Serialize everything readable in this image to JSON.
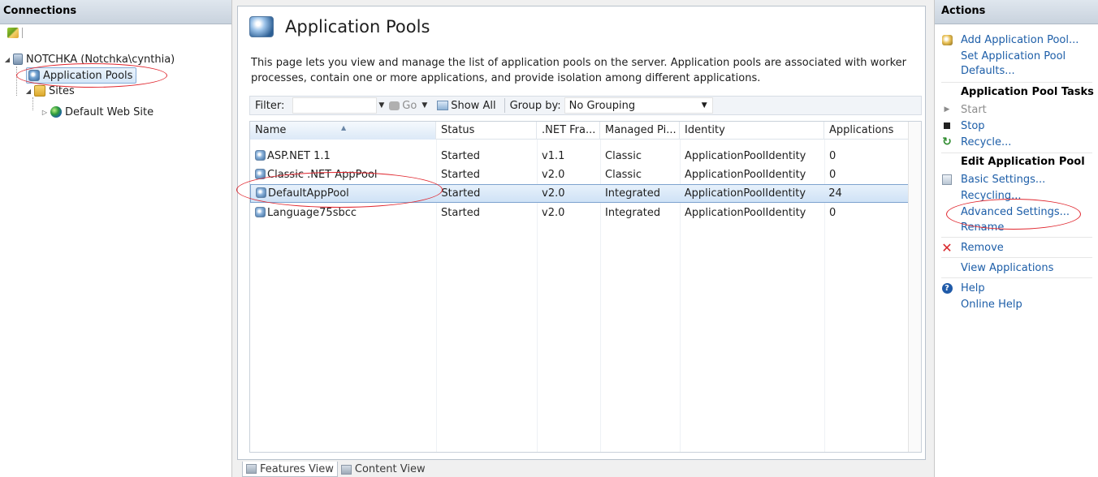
{
  "connections": {
    "title": "Connections",
    "tree": {
      "server": "NOTCHKA (Notchka\\cynthia)",
      "app_pools": "Application Pools",
      "sites": "Sites",
      "default_site": "Default Web Site"
    }
  },
  "main": {
    "title": "Application Pools",
    "description": "This page lets you view and manage the list of application pools on the server. Application pools are associated with worker processes, contain one or more applications, and provide isolation among different applications.",
    "filter": {
      "label": "Filter:",
      "value": "",
      "go": "Go",
      "show_all": "Show All",
      "group_by_label": "Group by:",
      "group_by_value": "No Grouping"
    },
    "columns": [
      "Name",
      "Status",
      ".NET Fra...",
      "Managed Pi...",
      "Identity",
      "Applications"
    ],
    "rows": [
      {
        "name": "ASP.NET 1.1",
        "status": "Started",
        "net": "v1.1",
        "pipeline": "Classic",
        "identity": "ApplicationPoolIdentity",
        "apps": "0"
      },
      {
        "name": "Classic .NET AppPool",
        "status": "Started",
        "net": "v2.0",
        "pipeline": "Classic",
        "identity": "ApplicationPoolIdentity",
        "apps": "0"
      },
      {
        "name": "DefaultAppPool",
        "status": "Started",
        "net": "v2.0",
        "pipeline": "Integrated",
        "identity": "ApplicationPoolIdentity",
        "apps": "24"
      },
      {
        "name": "Language75sbcc",
        "status": "Started",
        "net": "v2.0",
        "pipeline": "Integrated",
        "identity": "ApplicationPoolIdentity",
        "apps": "0"
      }
    ],
    "selected_row": "DefaultAppPool",
    "tabs": {
      "features": "Features View",
      "content": "Content View"
    }
  },
  "actions": {
    "title": "Actions",
    "add_pool": "Add Application Pool...",
    "set_defaults_1": "Set Application Pool",
    "set_defaults_2": "Defaults...",
    "tasks_heading": "Application Pool Tasks",
    "start": "Start",
    "stop": "Stop",
    "recycle": "Recycle...",
    "edit_heading": "Edit Application Pool",
    "basic_settings": "Basic Settings...",
    "recycling": "Recycling...",
    "advanced_settings": "Advanced Settings...",
    "rename": "Rename",
    "remove": "Remove",
    "view_applications": "View Applications",
    "help": "Help",
    "online_help": "Online Help"
  },
  "colors": {
    "link": "#1d5ea8",
    "callout": "#e0262e",
    "selection": "#cfe2f6"
  }
}
